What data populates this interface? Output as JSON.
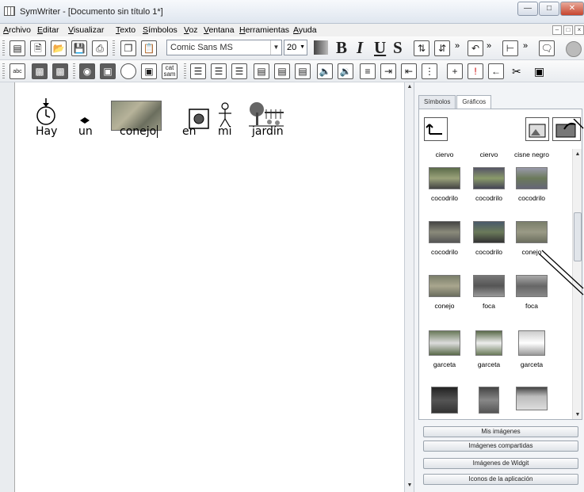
{
  "window": {
    "title": "SymWriter - [Documento sin título 1*]"
  },
  "menu": [
    "Archivo",
    "Editar",
    "Visualizar",
    "Texto",
    "Símbolos",
    "Voz",
    "Ventana",
    "Herramientas",
    "Ayuda"
  ],
  "toolbar": {
    "font_name": "Comic Sans MS",
    "font_size": "20",
    "bold": "B",
    "italic": "I",
    "underline": "U",
    "strike": "S",
    "spell_label": "abc",
    "catsam_label": "cat\nsam"
  },
  "document": {
    "words": [
      "Hay",
      "un",
      "conejo",
      "en",
      "mi",
      "jardín"
    ]
  },
  "panel": {
    "tabs": [
      "Símbolos",
      "Gráficos"
    ],
    "active_tab": "Gráficos",
    "gallery": [
      [
        "ciervo",
        "ciervo",
        "cisne negro"
      ],
      [
        "cocodrilo",
        "cocodrilo",
        "cocodrilo"
      ],
      [
        "cocodrilo",
        "cocodrilo",
        "conejo"
      ],
      [
        "conejo",
        "foca",
        "foca"
      ],
      [
        "garceta",
        "garceta",
        "garceta"
      ]
    ],
    "buttons": [
      "Mis imágenes",
      "Imágenes compartidas",
      "Imágenes de Widgit",
      "Iconos de la aplicación"
    ]
  }
}
